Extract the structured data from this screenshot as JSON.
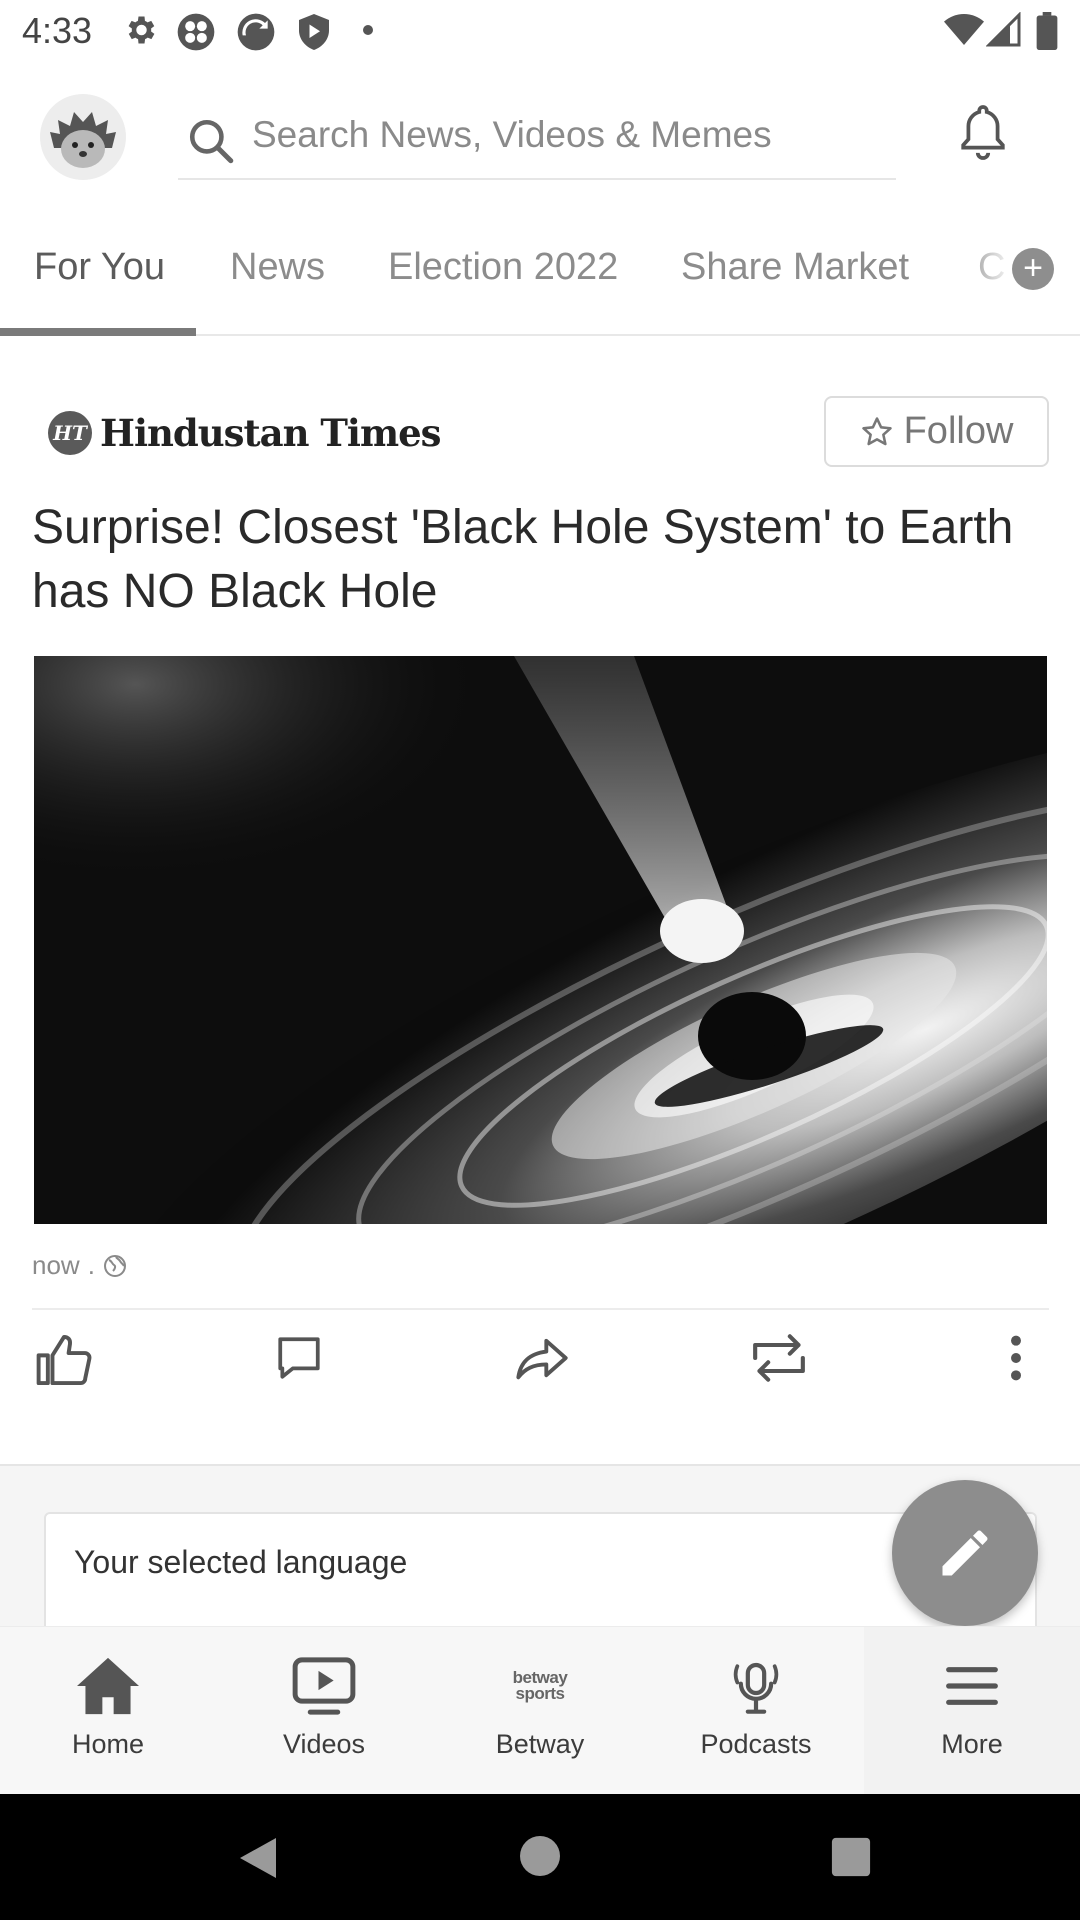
{
  "status_bar": {
    "time": "4:33",
    "icons": [
      "settings-icon",
      "app-icon",
      "app-icon",
      "shield-icon",
      "dot-icon",
      "wifi-icon",
      "signal-icon",
      "battery-icon"
    ]
  },
  "header": {
    "avatar_icon": "hedgehog-avatar-icon",
    "search_placeholder": "Search News, Videos & Memes",
    "notification_icon": "bell-icon"
  },
  "tabs": {
    "items": [
      {
        "label": "For You",
        "active": true
      },
      {
        "label": "News",
        "active": false
      },
      {
        "label": "Election 2022",
        "active": false
      },
      {
        "label": "Share Market",
        "active": false
      },
      {
        "label": "C",
        "active": false
      }
    ],
    "add_icon": "plus-icon"
  },
  "article": {
    "publisher_badge": "HT",
    "publisher": "Hindustan Times",
    "follow_label": "Follow",
    "headline": "Surprise! Closest 'Black Hole System' to Earth has NO Black Hole",
    "image_subject": "black-hole-illustration",
    "time": "now",
    "separator": ".",
    "actions": [
      "like-icon",
      "comment-icon",
      "share-icon",
      "repost-icon",
      "more-options-icon"
    ]
  },
  "language_card": {
    "title": "Your selected language"
  },
  "fab_icon": "pencil-icon",
  "bottom_nav": {
    "items": [
      {
        "label": "Home",
        "icon": "home-icon"
      },
      {
        "label": "Videos",
        "icon": "video-icon"
      },
      {
        "label": "Betway",
        "icon": "betway-logo-icon",
        "logo_text_1": "betway",
        "logo_text_2": "sports"
      },
      {
        "label": "Podcasts",
        "icon": "microphone-icon"
      },
      {
        "label": "More",
        "icon": "menu-icon"
      }
    ]
  },
  "colors": {
    "accent_gray": "#7a7a7a",
    "text_dark": "#2a2a2a",
    "text_muted": "#8c8c8c"
  }
}
